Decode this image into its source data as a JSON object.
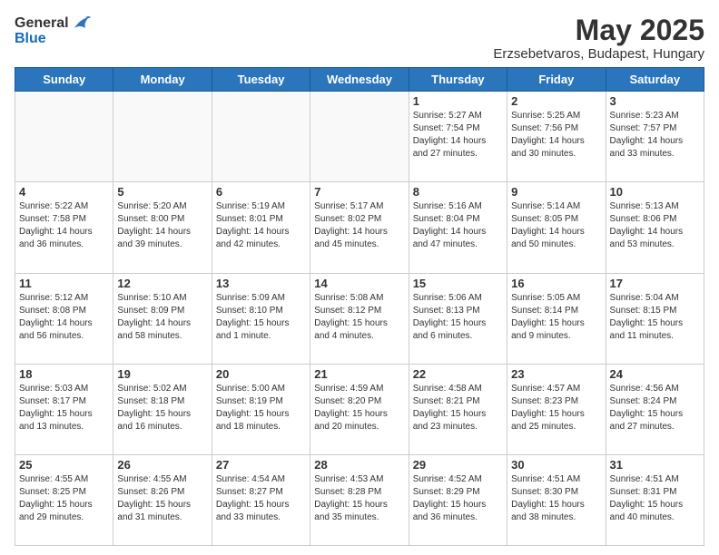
{
  "header": {
    "logo_general": "General",
    "logo_blue": "Blue",
    "month_title": "May 2025",
    "subtitle": "Erzsebetvaros, Budapest, Hungary"
  },
  "days_of_week": [
    "Sunday",
    "Monday",
    "Tuesday",
    "Wednesday",
    "Thursday",
    "Friday",
    "Saturday"
  ],
  "weeks": [
    [
      {
        "day": "",
        "info": ""
      },
      {
        "day": "",
        "info": ""
      },
      {
        "day": "",
        "info": ""
      },
      {
        "day": "",
        "info": ""
      },
      {
        "day": "1",
        "info": "Sunrise: 5:27 AM\nSunset: 7:54 PM\nDaylight: 14 hours\nand 27 minutes."
      },
      {
        "day": "2",
        "info": "Sunrise: 5:25 AM\nSunset: 7:56 PM\nDaylight: 14 hours\nand 30 minutes."
      },
      {
        "day": "3",
        "info": "Sunrise: 5:23 AM\nSunset: 7:57 PM\nDaylight: 14 hours\nand 33 minutes."
      }
    ],
    [
      {
        "day": "4",
        "info": "Sunrise: 5:22 AM\nSunset: 7:58 PM\nDaylight: 14 hours\nand 36 minutes."
      },
      {
        "day": "5",
        "info": "Sunrise: 5:20 AM\nSunset: 8:00 PM\nDaylight: 14 hours\nand 39 minutes."
      },
      {
        "day": "6",
        "info": "Sunrise: 5:19 AM\nSunset: 8:01 PM\nDaylight: 14 hours\nand 42 minutes."
      },
      {
        "day": "7",
        "info": "Sunrise: 5:17 AM\nSunset: 8:02 PM\nDaylight: 14 hours\nand 45 minutes."
      },
      {
        "day": "8",
        "info": "Sunrise: 5:16 AM\nSunset: 8:04 PM\nDaylight: 14 hours\nand 47 minutes."
      },
      {
        "day": "9",
        "info": "Sunrise: 5:14 AM\nSunset: 8:05 PM\nDaylight: 14 hours\nand 50 minutes."
      },
      {
        "day": "10",
        "info": "Sunrise: 5:13 AM\nSunset: 8:06 PM\nDaylight: 14 hours\nand 53 minutes."
      }
    ],
    [
      {
        "day": "11",
        "info": "Sunrise: 5:12 AM\nSunset: 8:08 PM\nDaylight: 14 hours\nand 56 minutes."
      },
      {
        "day": "12",
        "info": "Sunrise: 5:10 AM\nSunset: 8:09 PM\nDaylight: 14 hours\nand 58 minutes."
      },
      {
        "day": "13",
        "info": "Sunrise: 5:09 AM\nSunset: 8:10 PM\nDaylight: 15 hours\nand 1 minute."
      },
      {
        "day": "14",
        "info": "Sunrise: 5:08 AM\nSunset: 8:12 PM\nDaylight: 15 hours\nand 4 minutes."
      },
      {
        "day": "15",
        "info": "Sunrise: 5:06 AM\nSunset: 8:13 PM\nDaylight: 15 hours\nand 6 minutes."
      },
      {
        "day": "16",
        "info": "Sunrise: 5:05 AM\nSunset: 8:14 PM\nDaylight: 15 hours\nand 9 minutes."
      },
      {
        "day": "17",
        "info": "Sunrise: 5:04 AM\nSunset: 8:15 PM\nDaylight: 15 hours\nand 11 minutes."
      }
    ],
    [
      {
        "day": "18",
        "info": "Sunrise: 5:03 AM\nSunset: 8:17 PM\nDaylight: 15 hours\nand 13 minutes."
      },
      {
        "day": "19",
        "info": "Sunrise: 5:02 AM\nSunset: 8:18 PM\nDaylight: 15 hours\nand 16 minutes."
      },
      {
        "day": "20",
        "info": "Sunrise: 5:00 AM\nSunset: 8:19 PM\nDaylight: 15 hours\nand 18 minutes."
      },
      {
        "day": "21",
        "info": "Sunrise: 4:59 AM\nSunset: 8:20 PM\nDaylight: 15 hours\nand 20 minutes."
      },
      {
        "day": "22",
        "info": "Sunrise: 4:58 AM\nSunset: 8:21 PM\nDaylight: 15 hours\nand 23 minutes."
      },
      {
        "day": "23",
        "info": "Sunrise: 4:57 AM\nSunset: 8:23 PM\nDaylight: 15 hours\nand 25 minutes."
      },
      {
        "day": "24",
        "info": "Sunrise: 4:56 AM\nSunset: 8:24 PM\nDaylight: 15 hours\nand 27 minutes."
      }
    ],
    [
      {
        "day": "25",
        "info": "Sunrise: 4:55 AM\nSunset: 8:25 PM\nDaylight: 15 hours\nand 29 minutes."
      },
      {
        "day": "26",
        "info": "Sunrise: 4:55 AM\nSunset: 8:26 PM\nDaylight: 15 hours\nand 31 minutes."
      },
      {
        "day": "27",
        "info": "Sunrise: 4:54 AM\nSunset: 8:27 PM\nDaylight: 15 hours\nand 33 minutes."
      },
      {
        "day": "28",
        "info": "Sunrise: 4:53 AM\nSunset: 8:28 PM\nDaylight: 15 hours\nand 35 minutes."
      },
      {
        "day": "29",
        "info": "Sunrise: 4:52 AM\nSunset: 8:29 PM\nDaylight: 15 hours\nand 36 minutes."
      },
      {
        "day": "30",
        "info": "Sunrise: 4:51 AM\nSunset: 8:30 PM\nDaylight: 15 hours\nand 38 minutes."
      },
      {
        "day": "31",
        "info": "Sunrise: 4:51 AM\nSunset: 8:31 PM\nDaylight: 15 hours\nand 40 minutes."
      }
    ]
  ]
}
